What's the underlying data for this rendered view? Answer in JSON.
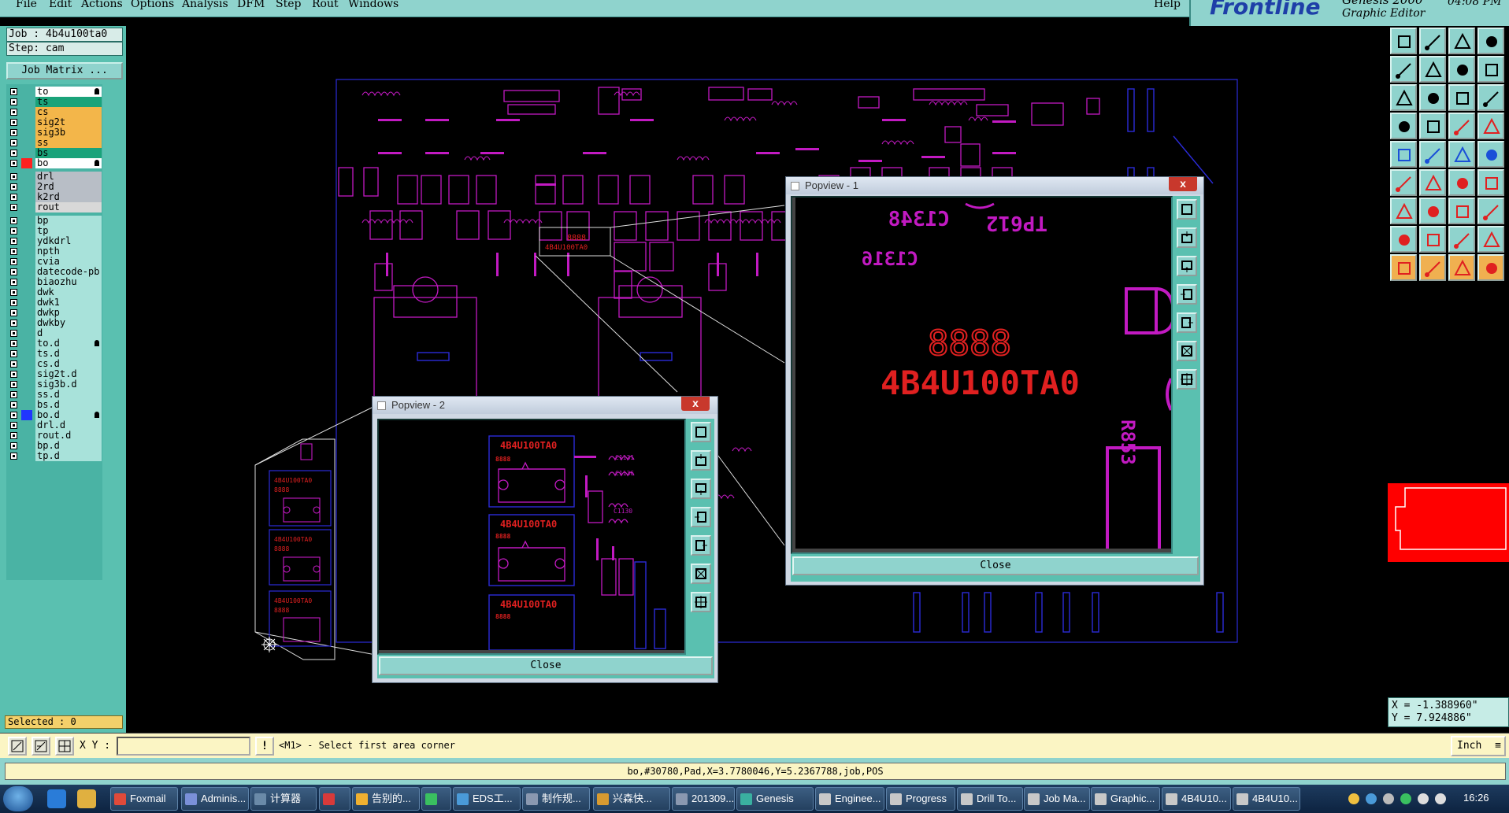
{
  "menubar": {
    "items": [
      "File",
      "Edit",
      "Actions",
      "Options",
      "Analysis",
      "DFM",
      "Step",
      "Rout",
      "Windows"
    ],
    "help": "Help"
  },
  "logo": {
    "brand": "Frontline",
    "version": "Genesis 2000",
    "subtitle": "Graphic Editor",
    "clock": "04:08 PM"
  },
  "job": {
    "job_label": "Job : 4b4u100ta0",
    "step_label": "Step: cam",
    "matrix_button": "Job Matrix ..."
  },
  "layers": [
    {
      "name": "to",
      "color": "#ffffff",
      "group": 1,
      "swatch": "",
      "mark": true
    },
    {
      "name": "ts",
      "color": "#1aa37a",
      "group": 1,
      "swatch": "",
      "mark": false
    },
    {
      "name": "cs",
      "color": "#f3b64a",
      "group": 1,
      "swatch": "",
      "mark": false
    },
    {
      "name": "sig2t",
      "color": "#f3b64a",
      "group": 1,
      "swatch": "",
      "mark": false
    },
    {
      "name": "sig3b",
      "color": "#f3b64a",
      "group": 1,
      "swatch": "",
      "mark": false
    },
    {
      "name": "ss",
      "color": "#f3b64a",
      "group": 1,
      "swatch": "",
      "mark": false
    },
    {
      "name": "bs",
      "color": "#1aa37a",
      "group": 1,
      "swatch": "",
      "mark": false
    },
    {
      "name": "bo",
      "color": "#ffffff",
      "group": 1,
      "swatch": "#ff2020",
      "mark": true
    },
    {
      "name": "drl",
      "color": "#b8bec6",
      "group": 2,
      "swatch": "",
      "mark": false
    },
    {
      "name": "2rd",
      "color": "#b8bec6",
      "group": 2,
      "swatch": "",
      "mark": false
    },
    {
      "name": "k2rd",
      "color": "#b8bec6",
      "group": 2,
      "swatch": "",
      "mark": false
    },
    {
      "name": "rout",
      "color": "#d8d8d8",
      "group": 2,
      "swatch": "",
      "mark": false
    },
    {
      "name": "bp",
      "color": "#a8e2da",
      "group": 3,
      "swatch": "",
      "mark": false
    },
    {
      "name": "tp",
      "color": "#a8e2da",
      "group": 3,
      "swatch": "",
      "mark": false
    },
    {
      "name": "ydkdrl",
      "color": "#a8e2da",
      "group": 3,
      "swatch": "",
      "mark": false
    },
    {
      "name": "npth",
      "color": "#a8e2da",
      "group": 3,
      "swatch": "",
      "mark": false
    },
    {
      "name": "cvia",
      "color": "#a8e2da",
      "group": 3,
      "swatch": "",
      "mark": false
    },
    {
      "name": "datecode-pb",
      "color": "#a8e2da",
      "group": 3,
      "swatch": "",
      "mark": false
    },
    {
      "name": "biaozhu",
      "color": "#a8e2da",
      "group": 3,
      "swatch": "",
      "mark": false
    },
    {
      "name": "dwk",
      "color": "#a8e2da",
      "group": 3,
      "swatch": "",
      "mark": false
    },
    {
      "name": "dwk1",
      "color": "#a8e2da",
      "group": 3,
      "swatch": "",
      "mark": false
    },
    {
      "name": "dwkp",
      "color": "#a8e2da",
      "group": 3,
      "swatch": "",
      "mark": false
    },
    {
      "name": "dwkby",
      "color": "#a8e2da",
      "group": 3,
      "swatch": "",
      "mark": false
    },
    {
      "name": "d",
      "color": "#a8e2da",
      "group": 3,
      "swatch": "",
      "mark": false
    },
    {
      "name": "to.d",
      "color": "#a8e2da",
      "group": 3,
      "swatch": "",
      "mark": true
    },
    {
      "name": "ts.d",
      "color": "#a8e2da",
      "group": 3,
      "swatch": "",
      "mark": false
    },
    {
      "name": "cs.d",
      "color": "#a8e2da",
      "group": 3,
      "swatch": "",
      "mark": false
    },
    {
      "name": "sig2t.d",
      "color": "#a8e2da",
      "group": 3,
      "swatch": "",
      "mark": false
    },
    {
      "name": "sig3b.d",
      "color": "#a8e2da",
      "group": 3,
      "swatch": "",
      "mark": false
    },
    {
      "name": "ss.d",
      "color": "#a8e2da",
      "group": 3,
      "swatch": "",
      "mark": false
    },
    {
      "name": "bs.d",
      "color": "#a8e2da",
      "group": 3,
      "swatch": "",
      "mark": false
    },
    {
      "name": "bo.d",
      "color": "#a8e2da",
      "group": 3,
      "swatch": "#2036ff",
      "mark": true
    },
    {
      "name": "drl.d",
      "color": "#a8e2da",
      "group": 3,
      "swatch": "",
      "mark": false
    },
    {
      "name": "rout.d",
      "color": "#a8e2da",
      "group": 3,
      "swatch": "",
      "mark": false
    },
    {
      "name": "bp.d",
      "color": "#a8e2da",
      "group": 3,
      "swatch": "",
      "mark": false
    },
    {
      "name": "tp.d",
      "color": "#a8e2da",
      "group": 3,
      "swatch": "",
      "mark": false
    }
  ],
  "selected": "Selected : 0",
  "popview1": {
    "title": "Popview - 1",
    "close_x": "x",
    "close_label": "Close",
    "texts": [
      "C1348",
      "TP612",
      "C1316",
      "8888",
      "4B4U100TA0",
      "R853"
    ]
  },
  "popview2": {
    "title": "Popview - 2",
    "close_x": "x",
    "close_label": "Close",
    "texts": [
      "4B4U100TA0",
      "8888",
      "C1131",
      "C1136",
      "C1130",
      "4B4U100TA0",
      "8888",
      "4B4U100TA0",
      "8888"
    ]
  },
  "board_texts": [
    "8888",
    "4B4U100TA0"
  ],
  "thumb_texts": [
    "4B4U100TA0",
    "8888",
    "4B4U100TA0",
    "8888",
    "4B4U100TA0",
    "8888"
  ],
  "coords": {
    "x": "X = -1.388960\"",
    "y": "Y = 7.924886\""
  },
  "command": {
    "xy_label": "X Y :",
    "xy_value": "",
    "warn": "!",
    "prompt": "<M1> - Select first area corner",
    "units": "Inch"
  },
  "status": "bo,#30780,Pad,X=3.7780046,Y=5.2367788,job,POS",
  "taskbar": {
    "tasks": [
      {
        "label": "Foxmail",
        "color": "#e04a3a"
      },
      {
        "label": "Adminis...",
        "color": "#7a90d8"
      },
      {
        "label": "计算器",
        "color": "#6a8aa8"
      },
      {
        "label": "",
        "color": "#d83a3a"
      },
      {
        "label": "告别的...",
        "color": "#f0b030"
      },
      {
        "label": "",
        "color": "#3ac060"
      },
      {
        "label": "EDS工...",
        "color": "#4a9ad8"
      },
      {
        "label": "制作规...",
        "color": "#8a98b0"
      },
      {
        "label": "兴森快...",
        "color": "#d89a30"
      },
      {
        "label": "201309...",
        "color": "#8a98b0"
      },
      {
        "label": "Genesis",
        "color": "#3ab0a0"
      },
      {
        "label": "Enginee...",
        "color": "#c8c8c8"
      },
      {
        "label": "Progress",
        "color": "#c8c8c8"
      },
      {
        "label": "Drill To...",
        "color": "#c8c8c8"
      },
      {
        "label": "Job Ma...",
        "color": "#c8c8c8"
      },
      {
        "label": "Graphic...",
        "color": "#c8c8c8"
      },
      {
        "label": "4B4U10...",
        "color": "#c8c8c8"
      },
      {
        "label": "4B4U10...",
        "color": "#c8c8c8"
      }
    ],
    "clock": "16:26"
  }
}
